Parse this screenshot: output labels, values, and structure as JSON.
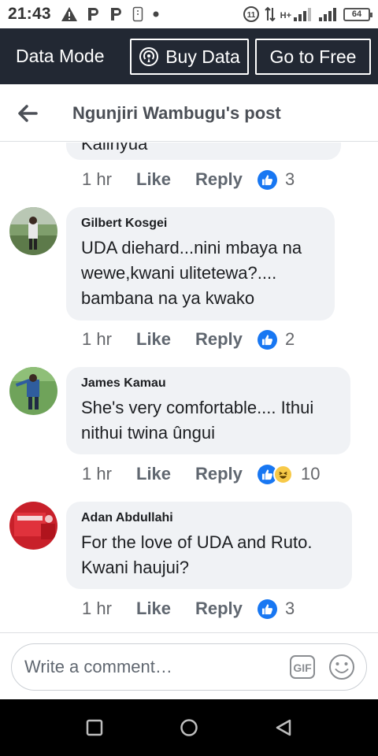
{
  "status_bar": {
    "time": "21:43",
    "left_icons": [
      "warning-icon",
      "p-app-icon",
      "p-app-icon",
      "sim-icon",
      "dot-icon"
    ],
    "network_glyph": "H+",
    "battery": "64"
  },
  "data_mode": {
    "label": "Data Mode",
    "buy_label": "Buy Data",
    "free_label": "Go to Free"
  },
  "header": {
    "title": "Ngunjiri Wambugu's post"
  },
  "feed": {
    "partial_comment": {
      "text_fragment": "Kalinyua",
      "time": "1 hr",
      "like": "Like",
      "reply": "Reply",
      "reactions": [
        "like"
      ],
      "count": "3"
    },
    "comments": [
      {
        "name": "Gilbert Kosgei",
        "text_lines": [
          "UDA diehard...nini mbaya na",
          "wewe,kwani ulitetewa?....",
          "bambana na ya kwako"
        ],
        "time": "1 hr",
        "like": "Like",
        "reply": "Reply",
        "reactions": [
          "like"
        ],
        "count": "2"
      },
      {
        "name": "James Kamau",
        "text_lines": [
          "She's very comfortable.... Ithui",
          "nithui twina ûngui"
        ],
        "time": "1 hr",
        "like": "Like",
        "reply": "Reply",
        "reactions": [
          "like",
          "haha"
        ],
        "count": "10"
      },
      {
        "name": "Adan Abdullahi",
        "text_lines": [
          "For the love of UDA and Ruto.",
          "Kwani haujui?"
        ],
        "time": "1 hr",
        "like": "Like",
        "reply": "Reply",
        "reactions": [
          "like"
        ],
        "count": "3"
      }
    ]
  },
  "composer": {
    "placeholder": "Write a comment…",
    "gif_label": "GIF"
  },
  "colors": {
    "data_bar_bg": "#222833",
    "bubble_bg": "#f0f2f5",
    "like_blue": "#1877f2"
  }
}
